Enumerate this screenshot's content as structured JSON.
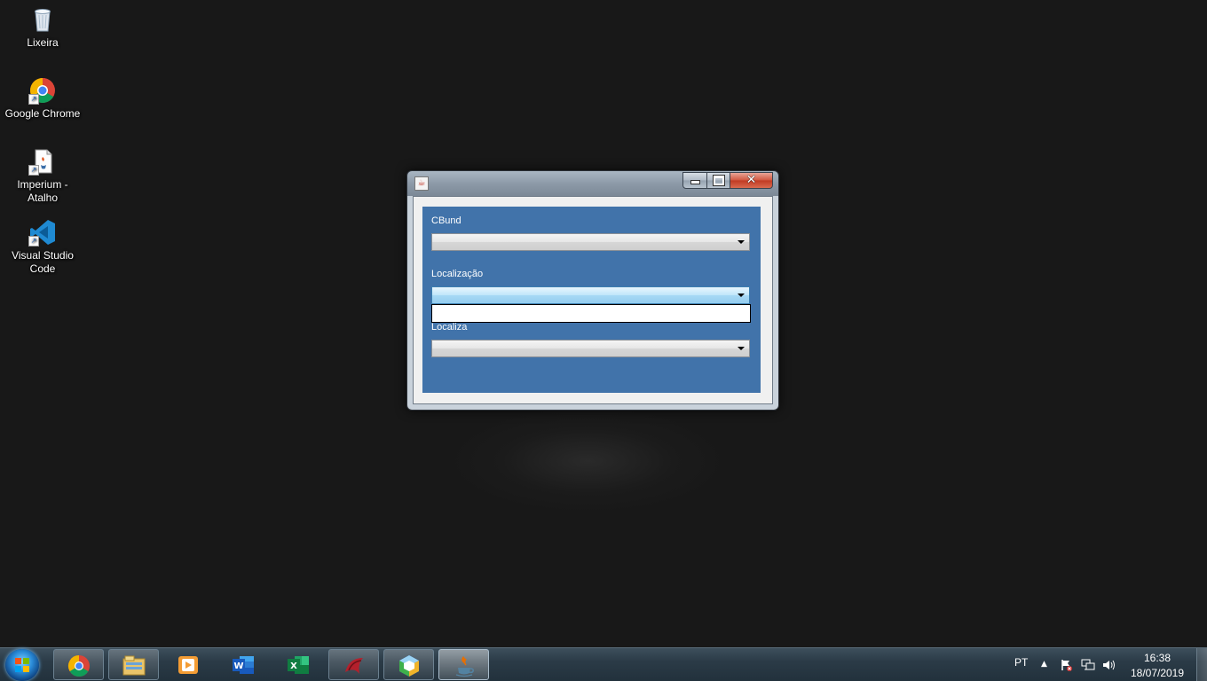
{
  "desktop": {
    "icons": [
      {
        "label": "Lixeira",
        "icon": "recycle-bin-icon"
      },
      {
        "label": "Google Chrome",
        "icon": "chrome-icon"
      },
      {
        "label": "Imperium - Atalho",
        "icon": "java-shortcut-icon"
      },
      {
        "label": "Visual Studio Code",
        "icon": "vscode-icon"
      }
    ]
  },
  "window": {
    "title": "",
    "fields": [
      {
        "label": "CBund",
        "value": ""
      },
      {
        "label": "Localização",
        "value": ""
      },
      {
        "label": "Localiza",
        "value": ""
      }
    ],
    "colors": {
      "panel": "#4173aa",
      "close": "#c13a22"
    }
  },
  "taskbar": {
    "apps": [
      {
        "name": "chrome-icon"
      },
      {
        "name": "file-explorer-icon"
      },
      {
        "name": "media-player-icon"
      },
      {
        "name": "word-icon"
      },
      {
        "name": "excel-icon"
      },
      {
        "name": "red-app-icon"
      },
      {
        "name": "netbeans-icon"
      },
      {
        "name": "java-icon"
      }
    ],
    "language": "PT",
    "time": "16:38",
    "date": "18/07/2019"
  }
}
